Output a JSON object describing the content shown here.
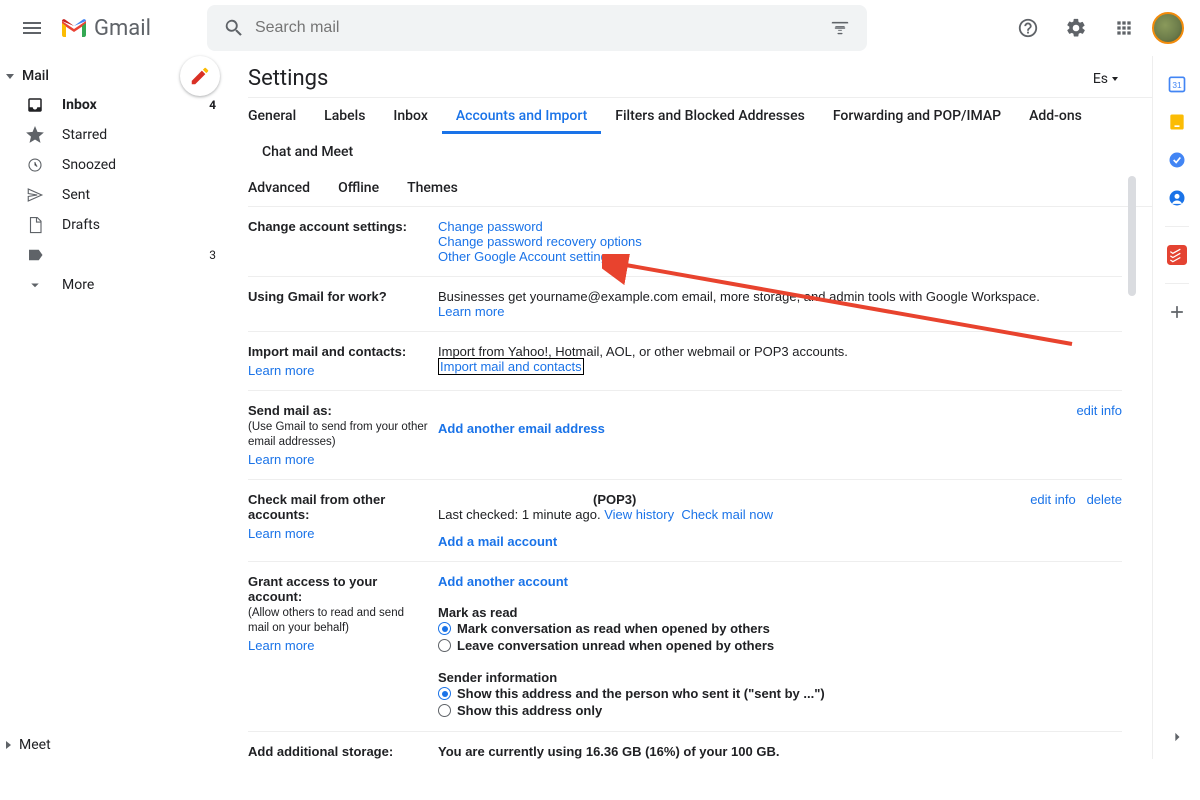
{
  "app": {
    "name": "Gmail"
  },
  "search": {
    "placeholder": "Search mail"
  },
  "sidebar": {
    "header": "Mail",
    "items": [
      {
        "label": "Inbox",
        "count": "4"
      },
      {
        "label": "Starred",
        "count": ""
      },
      {
        "label": "Snoozed",
        "count": ""
      },
      {
        "label": "Sent",
        "count": ""
      },
      {
        "label": "Drafts",
        "count": ""
      },
      {
        "label": "",
        "count": "3"
      },
      {
        "label": "More",
        "count": ""
      }
    ],
    "bottom": "Meet"
  },
  "settings": {
    "title": "Settings",
    "lang": "Es",
    "tabs": [
      "General",
      "Labels",
      "Inbox",
      "Accounts and Import",
      "Filters and Blocked Addresses",
      "Forwarding and POP/IMAP",
      "Add-ons",
      "Chat and Meet",
      "Advanced",
      "Offline",
      "Themes"
    ],
    "active_tab_index": 3
  },
  "sections": {
    "change": {
      "label": "Change account settings:",
      "links": [
        "Change password",
        "Change password recovery options",
        "Other Google Account settings"
      ]
    },
    "work": {
      "label": "Using Gmail for work?",
      "text": "Businesses get yourname@example.com email, more storage, and admin tools with Google Workspace.",
      "learn": "Learn more"
    },
    "import": {
      "label": "Import mail and contacts:",
      "learn": "Learn more",
      "text": "Import from Yahoo!, Hotmail, AOL, or other webmail or POP3 accounts.",
      "link": "Import mail and contacts"
    },
    "sendas": {
      "label": "Send mail as:",
      "sub": "(Use Gmail to send from your other email addresses)",
      "learn": "Learn more",
      "link": "Add another email address",
      "edit": "edit info"
    },
    "check": {
      "label": "Check mail from other accounts:",
      "learn": "Learn more",
      "pop": "(POP3)",
      "last": "Last checked: 1 minute ago.",
      "history": "View history",
      "now": "Check mail now",
      "add": "Add a mail account",
      "edit": "edit info",
      "delete": "delete"
    },
    "grant": {
      "label": "Grant access to your account:",
      "sub": "(Allow others to read and send mail on your behalf)",
      "learn": "Learn more",
      "add": "Add another account",
      "mark_header": "Mark as read",
      "mark_r1": "Mark conversation as read when opened by others",
      "mark_r2": "Leave conversation unread when opened by others",
      "sender_header": "Sender information",
      "sender_r1": "Show this address and the person who sent it (\"sent by ...\")",
      "sender_r2": "Show this address only"
    },
    "storage": {
      "label": "Add additional storage:",
      "text": "You are currently using 16.36 GB (16%) of your 100 GB."
    }
  }
}
